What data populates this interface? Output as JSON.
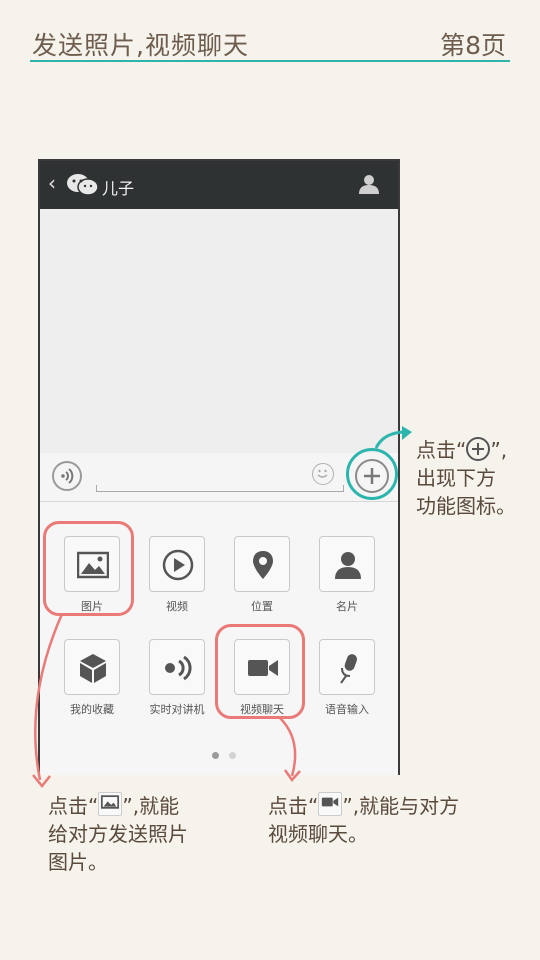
{
  "header": {
    "title": "发送照片,视频聊天",
    "page": "第8页",
    "rule_color": "#2bb5ac"
  },
  "chat": {
    "back_icon": "chevron-left-icon",
    "app_icon": "wechat-icon",
    "title": "儿子",
    "profile_icon": "person-icon",
    "voice_icon": "voice-icon",
    "emoji_icon": "emoji-icon",
    "plus_icon": "plus-icon"
  },
  "panel": {
    "items": [
      {
        "label": "图片",
        "icon": "image-icon"
      },
      {
        "label": "视频",
        "icon": "play-icon"
      },
      {
        "label": "位置",
        "icon": "location-pin-icon"
      },
      {
        "label": "名片",
        "icon": "person-icon"
      },
      {
        "label": "我的收藏",
        "icon": "cube-icon"
      },
      {
        "label": "实时对讲机",
        "icon": "walkie-talkie-icon"
      },
      {
        "label": "视频聊天",
        "icon": "video-camera-icon"
      },
      {
        "label": "语音输入",
        "icon": "microphone-icon"
      }
    ],
    "page_dots": {
      "count": 2,
      "active": 0
    }
  },
  "annotations": {
    "plus": {
      "prefix": "点击“",
      "suffix": "”,",
      "line2": "出现下方",
      "line3": "功能图标。"
    },
    "photo": {
      "prefix": "点击“",
      "suffix": "”,就能",
      "line2": "给对方发送照片",
      "line3": "图片。",
      "mini_label": "图片"
    },
    "video": {
      "prefix": "点击“",
      "suffix": "”,就能与对方",
      "line2": "视频聊天。",
      "mini_label": "视频聊天"
    }
  },
  "colors": {
    "highlight_pink": "#e97a78",
    "highlight_teal": "#2bb5ac",
    "topbar": "#2f3233"
  }
}
